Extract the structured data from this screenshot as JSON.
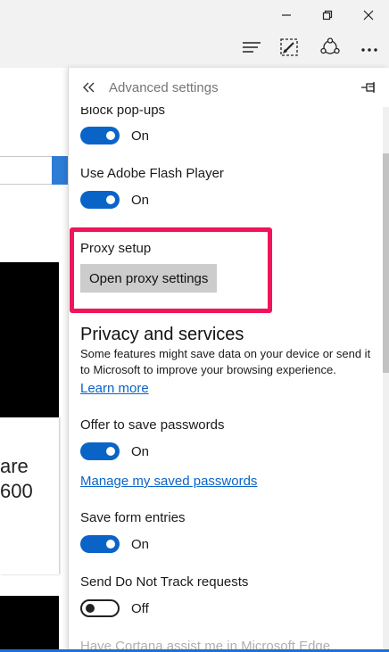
{
  "window": {
    "minimize_icon": "minimize-icon",
    "restore_icon": "restore-icon",
    "close_icon": "close-icon"
  },
  "toolbar": {
    "hub_icon": "hub-icon",
    "note_icon": "web-note-icon",
    "share_icon": "share-icon",
    "more_icon": "more-icon"
  },
  "background": {
    "line1": "are",
    "line2": "600"
  },
  "panel": {
    "title": "Advanced settings",
    "back_icon": "double-chevron-left-icon",
    "pin_icon": "pin-icon"
  },
  "settings": {
    "block_popups": {
      "label": "Block pop-ups",
      "state": "On"
    },
    "flash": {
      "label": "Use Adobe Flash Player",
      "state": "On"
    },
    "proxy": {
      "label": "Proxy setup",
      "button": "Open proxy settings"
    },
    "privacy": {
      "title": "Privacy and services",
      "description": "Some features might save data on your device or send it to Microsoft to improve your browsing experience.",
      "learn_more": "Learn more"
    },
    "passwords": {
      "label": "Offer to save passwords",
      "state": "On",
      "manage_link": "Manage my saved passwords"
    },
    "form_entries": {
      "label": "Save form entries",
      "state": "On"
    },
    "dnt": {
      "label": "Send Do Not Track requests",
      "state": "Off"
    },
    "cortana": {
      "label": "Have Cortana assist me in Microsoft Edge"
    }
  },
  "colors": {
    "accent": "#0a64c8",
    "highlight": "#f0145a",
    "button_bg": "#cccccc"
  }
}
